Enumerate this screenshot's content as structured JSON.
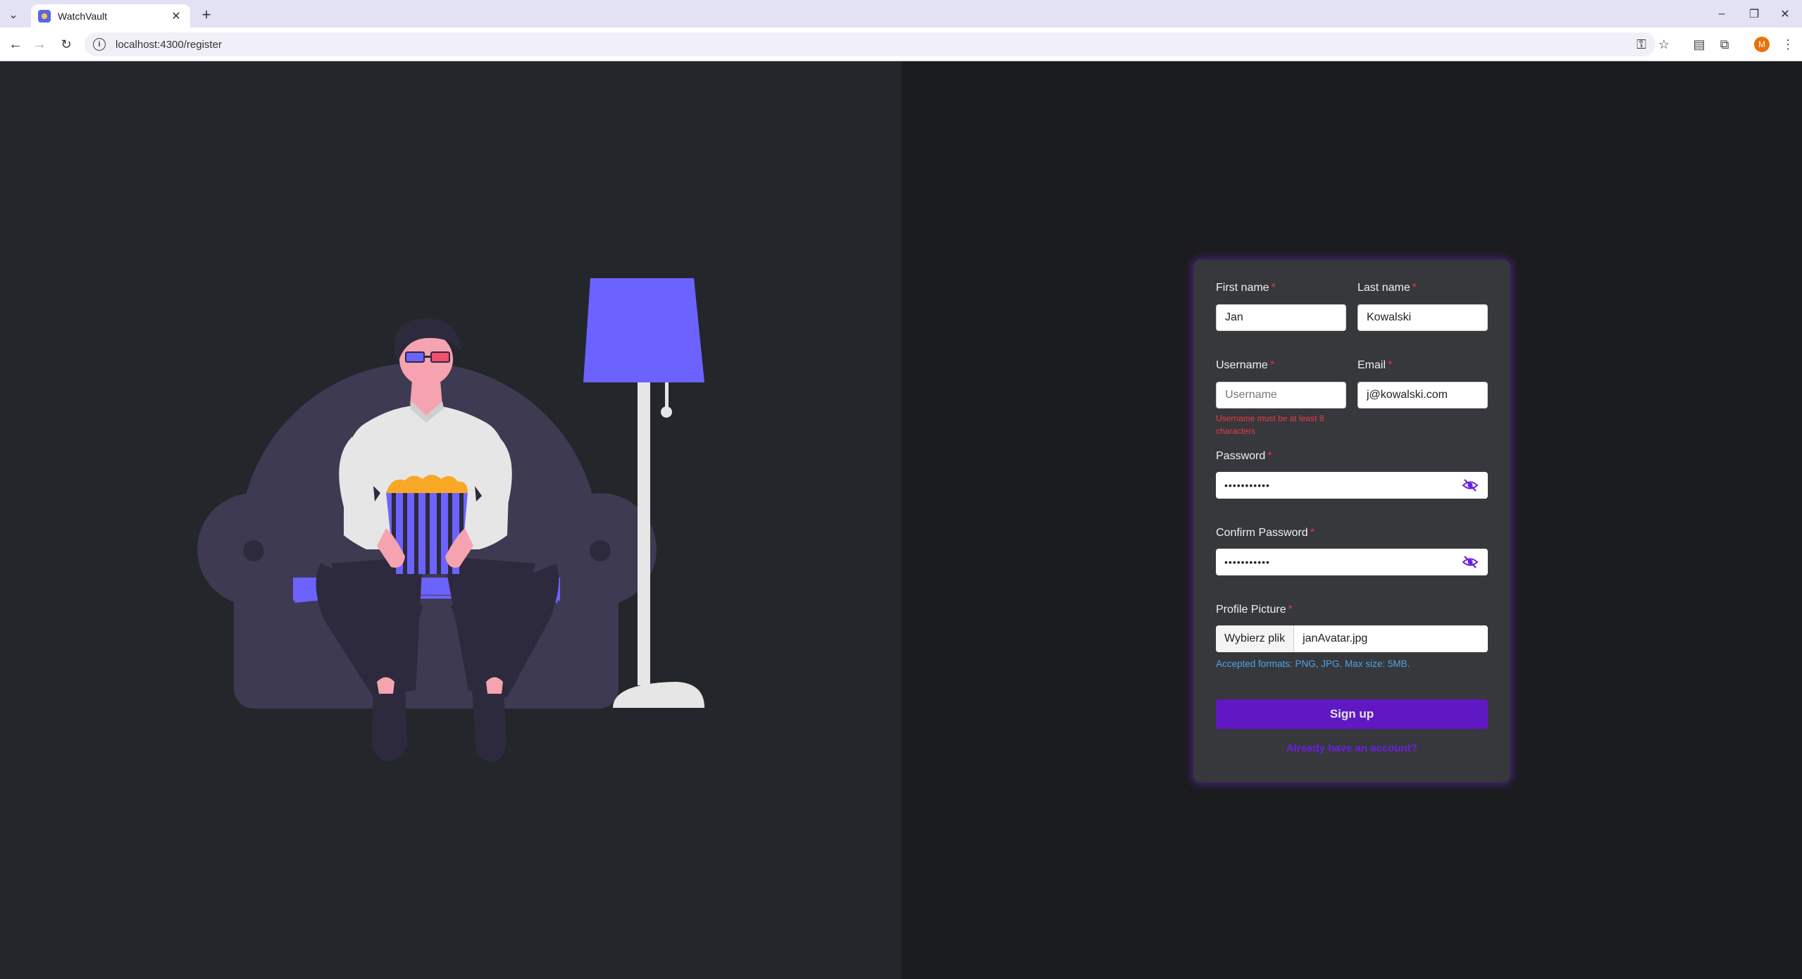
{
  "browser": {
    "tab_title": "WatchVault",
    "url": "localhost:4300/register",
    "profile_initial": "M"
  },
  "form": {
    "first_name": {
      "label": "First name",
      "value": "Jan"
    },
    "last_name": {
      "label": "Last name",
      "value": "Kowalski"
    },
    "username": {
      "label": "Username",
      "value": "",
      "placeholder": "Username",
      "error": "Username must be at least 8 characters"
    },
    "email": {
      "label": "Email",
      "value": "j@kowalski.com"
    },
    "password": {
      "label": "Password",
      "masked_value": "•••••••••••"
    },
    "confirm_password": {
      "label": "Confirm Password",
      "masked_value": "•••••••••••"
    },
    "profile_picture": {
      "label": "Profile Picture",
      "button_label": "Wybierz plik",
      "file_name": "janAvatar.jpg",
      "hint": "Accepted formats: PNG, JPG. Max size: 5MB."
    },
    "required_marker": "*",
    "submit_label": "Sign up",
    "login_link": "Already have an account?"
  },
  "colors": {
    "accent_purple": "#5f18c4",
    "illustration_purple": "#6c63ff",
    "error_red": "#ee3a4a",
    "hint_blue": "#4fa3e8"
  }
}
